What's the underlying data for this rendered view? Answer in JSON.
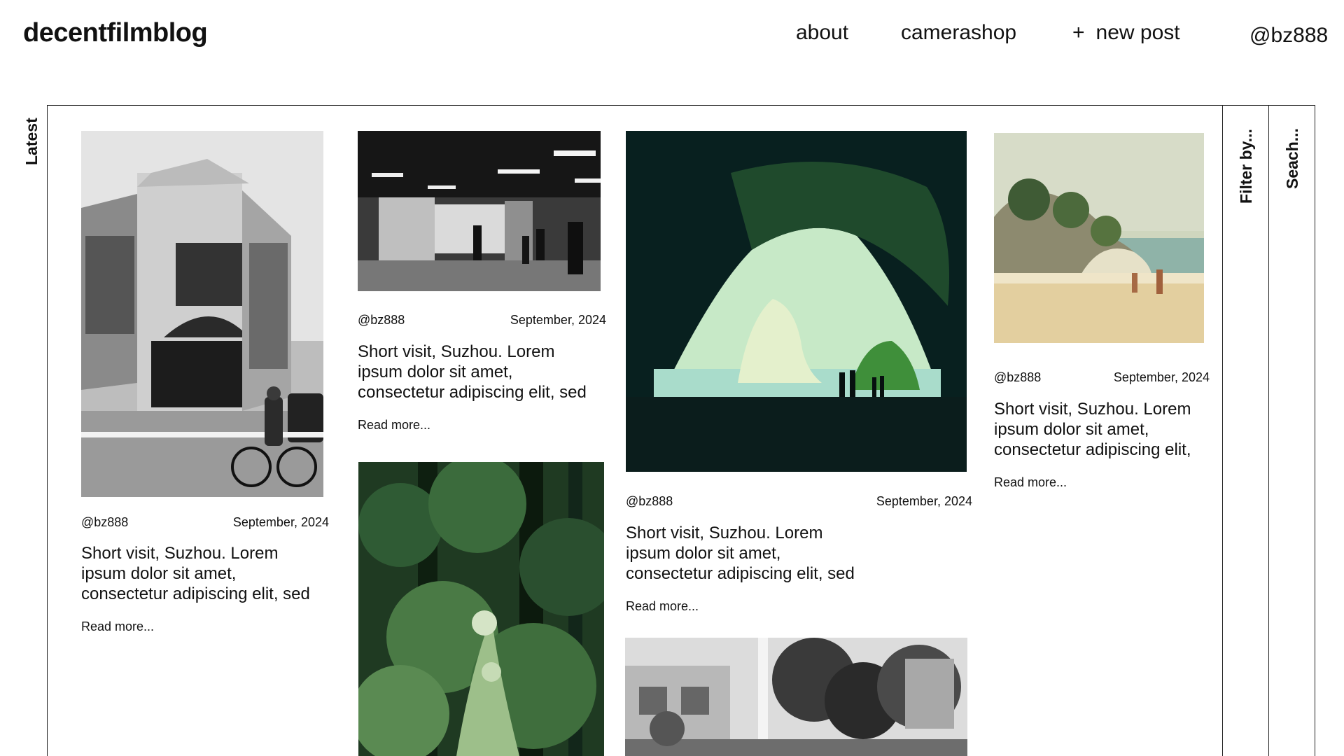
{
  "header": {
    "logo": "decentfilmblog",
    "nav": {
      "about": "about",
      "camerashop": "camerashop",
      "new_post_icon": "+",
      "new_post": "new post",
      "user": "@bz888"
    }
  },
  "side_labels": {
    "latest": "Latest",
    "filter": "Filter by...",
    "search": "Seach..."
  },
  "posts": [
    {
      "author": "@bz888",
      "date": "September, 2024",
      "title": "Short visit, Suzhou. Lorem ipsum dolor sit amet, consectetur adipiscing elit, sed",
      "read_more": "Read more...",
      "photo": "bw-ornate-building-cyclist"
    },
    {
      "author": "@bz888",
      "date": "September, 2024",
      "title": "Short visit, Suzhou. Lorem ipsum dolor sit amet, consectetur adipiscing elit, sed",
      "read_more": "Read more...",
      "photo": "bw-subway-station"
    },
    {
      "author": "@bz888",
      "date": "September, 2024",
      "title": "Short visit, Suzhou. Lorem ipsum dolor sit amet, consectetur adipiscing elit, sed",
      "read_more": "Read more...",
      "photo": "green-sea-cave-arch"
    },
    {
      "author": "@bz888",
      "date": "September, 2024",
      "title": "Short visit, Suzhou. Lorem ipsum dolor sit amet, consectetur adipiscing elit,",
      "read_more": "Read more...",
      "photo": "beach-rock-arch"
    },
    {
      "photo": "green-forest-path"
    },
    {
      "photo": "bw-houses-trees"
    }
  ]
}
